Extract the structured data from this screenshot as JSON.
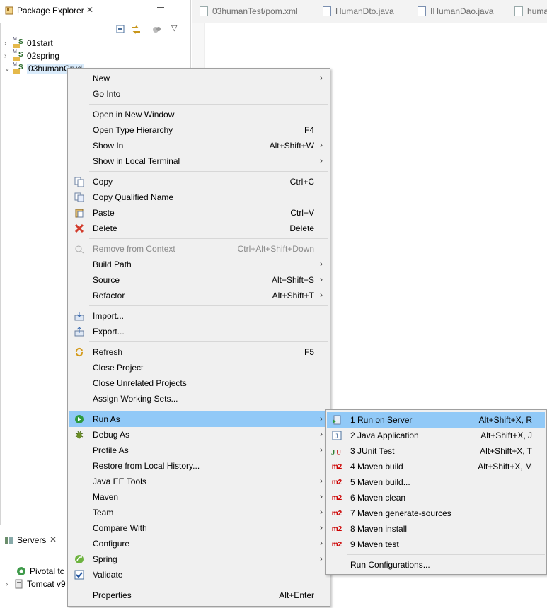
{
  "package_explorer": {
    "title": "Package Explorer",
    "projects": [
      {
        "name": "01start",
        "expanded": false
      },
      {
        "name": "02spring",
        "expanded": false
      },
      {
        "name": "03humanCrud",
        "expanded": true
      }
    ]
  },
  "editor_tabs": [
    {
      "label": "03humanTest/pom.xml",
      "icon": "xml-file-icon"
    },
    {
      "label": "HumanDto.java",
      "icon": "java-file-icon"
    },
    {
      "label": "IHumanDao.java",
      "icon": "java-file-icon"
    },
    {
      "label": "huma",
      "icon": "xml-file-icon"
    }
  ],
  "servers": {
    "title": "Servers",
    "items": [
      "Pivotal tc",
      "Tomcat v9"
    ]
  },
  "context_menu": {
    "items": [
      {
        "label": "New",
        "shortcut": "",
        "submenu": true,
        "icon": ""
      },
      {
        "label": "Go Into",
        "shortcut": "",
        "submenu": false,
        "icon": ""
      },
      {
        "label": "Open in New Window",
        "shortcut": "",
        "submenu": false,
        "icon": ""
      },
      {
        "label": "Open Type Hierarchy",
        "shortcut": "F4",
        "submenu": false,
        "icon": ""
      },
      {
        "label": "Show In",
        "shortcut": "Alt+Shift+W",
        "submenu": true,
        "icon": ""
      },
      {
        "label": "Show in Local Terminal",
        "shortcut": "",
        "submenu": true,
        "icon": ""
      },
      {
        "label": "Copy",
        "shortcut": "Ctrl+C",
        "submenu": false,
        "icon": "copy-icon"
      },
      {
        "label": "Copy Qualified Name",
        "shortcut": "",
        "submenu": false,
        "icon": "copy-qualified-icon"
      },
      {
        "label": "Paste",
        "shortcut": "Ctrl+V",
        "submenu": false,
        "icon": "paste-icon"
      },
      {
        "label": "Delete",
        "shortcut": "Delete",
        "submenu": false,
        "icon": "delete-icon"
      },
      {
        "label": "Remove from Context",
        "shortcut": "Ctrl+Alt+Shift+Down",
        "submenu": false,
        "icon": "remove-context-icon",
        "disabled": true
      },
      {
        "label": "Build Path",
        "shortcut": "",
        "submenu": true,
        "icon": ""
      },
      {
        "label": "Source",
        "shortcut": "Alt+Shift+S",
        "submenu": true,
        "icon": ""
      },
      {
        "label": "Refactor",
        "shortcut": "Alt+Shift+T",
        "submenu": true,
        "icon": ""
      },
      {
        "label": "Import...",
        "shortcut": "",
        "submenu": false,
        "icon": "import-icon"
      },
      {
        "label": "Export...",
        "shortcut": "",
        "submenu": false,
        "icon": "export-icon"
      },
      {
        "label": "Refresh",
        "shortcut": "F5",
        "submenu": false,
        "icon": "refresh-icon"
      },
      {
        "label": "Close Project",
        "shortcut": "",
        "submenu": false,
        "icon": ""
      },
      {
        "label": "Close Unrelated Projects",
        "shortcut": "",
        "submenu": false,
        "icon": ""
      },
      {
        "label": "Assign Working Sets...",
        "shortcut": "",
        "submenu": false,
        "icon": ""
      },
      {
        "label": "Run As",
        "shortcut": "",
        "submenu": true,
        "icon": "run-icon",
        "highlighted": true
      },
      {
        "label": "Debug As",
        "shortcut": "",
        "submenu": true,
        "icon": "debug-icon"
      },
      {
        "label": "Profile As",
        "shortcut": "",
        "submenu": true,
        "icon": ""
      },
      {
        "label": "Restore from Local History...",
        "shortcut": "",
        "submenu": false,
        "icon": ""
      },
      {
        "label": "Java EE Tools",
        "shortcut": "",
        "submenu": true,
        "icon": ""
      },
      {
        "label": "Maven",
        "shortcut": "",
        "submenu": true,
        "icon": ""
      },
      {
        "label": "Team",
        "shortcut": "",
        "submenu": true,
        "icon": ""
      },
      {
        "label": "Compare With",
        "shortcut": "",
        "submenu": true,
        "icon": ""
      },
      {
        "label": "Configure",
        "shortcut": "",
        "submenu": true,
        "icon": ""
      },
      {
        "label": "Spring",
        "shortcut": "",
        "submenu": true,
        "icon": "spring-icon"
      },
      {
        "label": "Validate",
        "shortcut": "",
        "submenu": false,
        "icon": "validate-checkbox-icon"
      },
      {
        "label": "Properties",
        "shortcut": "Alt+Enter",
        "submenu": false,
        "icon": ""
      }
    ]
  },
  "run_as_submenu": {
    "items": [
      {
        "label": "1 Run on Server",
        "shortcut": "Alt+Shift+X, R",
        "icon": "run-on-server-icon",
        "highlighted": true
      },
      {
        "label": "2 Java Application",
        "shortcut": "Alt+Shift+X, J",
        "icon": "java-app-icon"
      },
      {
        "label": "3 JUnit Test",
        "shortcut": "Alt+Shift+X, T",
        "icon": "junit-icon"
      },
      {
        "label": "4 Maven build",
        "shortcut": "Alt+Shift+X, M",
        "icon": "maven-icon"
      },
      {
        "label": "5 Maven build...",
        "shortcut": "",
        "icon": "maven-icon"
      },
      {
        "label": "6 Maven clean",
        "shortcut": "",
        "icon": "maven-icon"
      },
      {
        "label": "7 Maven generate-sources",
        "shortcut": "",
        "icon": "maven-icon"
      },
      {
        "label": "8 Maven install",
        "shortcut": "",
        "icon": "maven-icon"
      },
      {
        "label": "9 Maven test",
        "shortcut": "",
        "icon": "maven-icon"
      },
      {
        "label": "Run Configurations...",
        "shortcut": "",
        "icon": ""
      }
    ]
  }
}
